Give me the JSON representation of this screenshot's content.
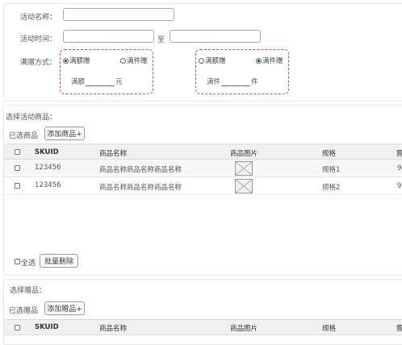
{
  "form": {
    "name_label": "活动名称：",
    "time_label": "活动时间：",
    "time_separator": "至",
    "gift_mode_label": "满赠方式：",
    "option_left": {
      "radio_amount": "满额赠",
      "radio_count": "满件赠",
      "selected": "amount",
      "text_before": "满额",
      "text_after": "元"
    },
    "option_right": {
      "radio_amount": "满额赠",
      "radio_count": "满件赠",
      "selected": "count",
      "text_before": "满件",
      "text_after": "件"
    }
  },
  "goods": {
    "section_title": "选择活动商品：",
    "selected_label": "已选商品",
    "add_button": "添加商品+",
    "columns": [
      "SKUID",
      "商品名称",
      "商品图片",
      "规格",
      "售"
    ],
    "rows": [
      {
        "skuid": "123456",
        "name": "商品名称商品名称商品名称",
        "spec": "规格1",
        "price_partial": "9"
      },
      {
        "skuid": "123456",
        "name": "商品名称商品名称商品名称",
        "spec": "规格2",
        "price_partial": "9"
      }
    ],
    "select_all": "全选",
    "batch_delete": "批量删除"
  },
  "gifts": {
    "section_title": "选择赠品：",
    "selected_label": "已选赠品",
    "add_button": "添加赠品+",
    "columns": [
      "SKUID",
      "商品名称",
      "商品图片",
      "规格",
      "售"
    ]
  },
  "colors": {
    "accent_dashed": "#e04545",
    "table_header_bg": "#f0f0f0"
  }
}
